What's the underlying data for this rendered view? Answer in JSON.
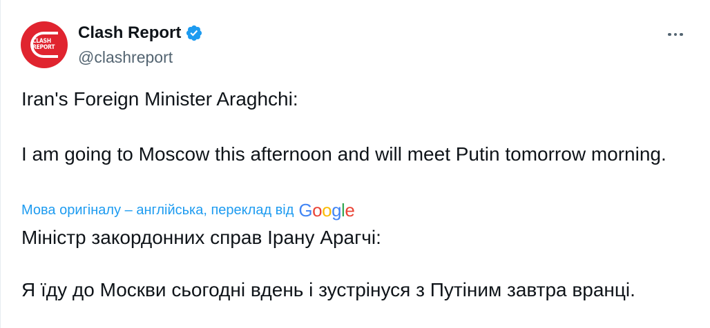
{
  "author": {
    "avatar": {
      "line1": "CLASH",
      "line2": "REPORT",
      "color": "#e0242f"
    },
    "display_name": "Clash Report",
    "verified_icon": "verified-badge-icon",
    "handle": "@clashreport"
  },
  "more_icon": "more-horizontal-icon",
  "tweet": {
    "line1": "Iran's Foreign Minister Araghchi:",
    "line2": "I am going to Moscow this afternoon and will meet Putin tomorrow morning."
  },
  "translation": {
    "link_text": "Мова оригіналу – англійська, переклад від",
    "provider": {
      "G": "G",
      "o1": "o",
      "o2": "o",
      "g": "g",
      "l": "l",
      "e": "e"
    },
    "line1": "Міністр закордонних справ Ірану Арагчі:",
    "line2": "Я їду до Москви сьогодні вдень і зустрінуся з Путіним завтра вранці."
  },
  "colors": {
    "link": "#1d9bf0",
    "verified": "#1d9bf0",
    "secondary_text": "#536471",
    "primary_text": "#0f1419"
  }
}
